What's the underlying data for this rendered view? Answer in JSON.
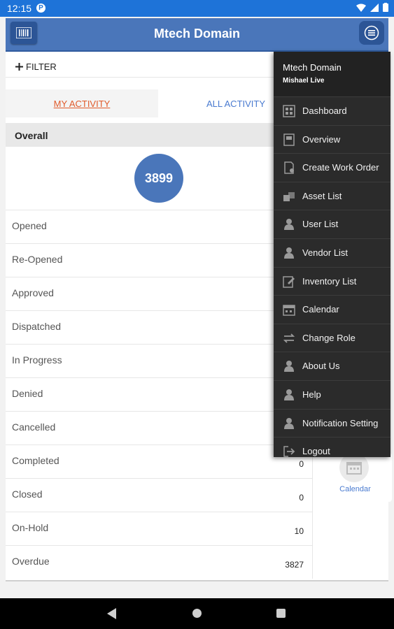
{
  "status_bar": {
    "time": "12:15",
    "badge": "P"
  },
  "app_bar": {
    "title": "Mtech Domain"
  },
  "filter": {
    "label": "FILTER"
  },
  "tabs": [
    {
      "label": "MY ACTIVITY",
      "active": true
    },
    {
      "label": "ALL ACTIVITY",
      "active": false
    }
  ],
  "overall": {
    "label": "Overall",
    "total": "3899"
  },
  "statuses": [
    {
      "label": "Opened",
      "count": ""
    },
    {
      "label": "Re-Opened",
      "count": ""
    },
    {
      "label": "Approved",
      "count": ""
    },
    {
      "label": "Dispatched",
      "count": ""
    },
    {
      "label": "In Progress",
      "count": ""
    },
    {
      "label": "Denied",
      "count": ""
    },
    {
      "label": "Cancelled",
      "count": ""
    },
    {
      "label": "Completed",
      "count": "0"
    },
    {
      "label": "Closed",
      "count": "0"
    },
    {
      "label": "On-Hold",
      "count": "10"
    },
    {
      "label": "Overdue",
      "count": "3827"
    }
  ],
  "right_panel": {
    "calendar_label": "Calendar"
  },
  "drawer": {
    "title": "Mtech Domain",
    "subtitle": "Mishael Live",
    "items": [
      {
        "label": "Dashboard",
        "icon": "grid-icon"
      },
      {
        "label": "Overview",
        "icon": "overview-icon"
      },
      {
        "label": "Create Work Order",
        "icon": "create-work-order-icon"
      },
      {
        "label": "Asset List",
        "icon": "asset-icon"
      },
      {
        "label": "User List",
        "icon": "user-icon"
      },
      {
        "label": "Vendor List",
        "icon": "user-icon"
      },
      {
        "label": "Inventory List",
        "icon": "edit-icon"
      },
      {
        "label": "Calendar",
        "icon": "calendar-icon"
      },
      {
        "label": "Change Role",
        "icon": "swap-icon"
      },
      {
        "label": "About Us",
        "icon": "user-icon"
      },
      {
        "label": "Help",
        "icon": "user-icon"
      },
      {
        "label": "Notification Setting",
        "icon": "user-icon"
      },
      {
        "label": "Logout",
        "icon": "logout-icon"
      }
    ]
  },
  "colors": {
    "status_bar": "#1e73d8",
    "app_bar": "#4a76ba",
    "active_tab": "#e05a2a",
    "inactive_tab": "#4a7bd0",
    "drawer_bg": "#2b2b2b"
  }
}
